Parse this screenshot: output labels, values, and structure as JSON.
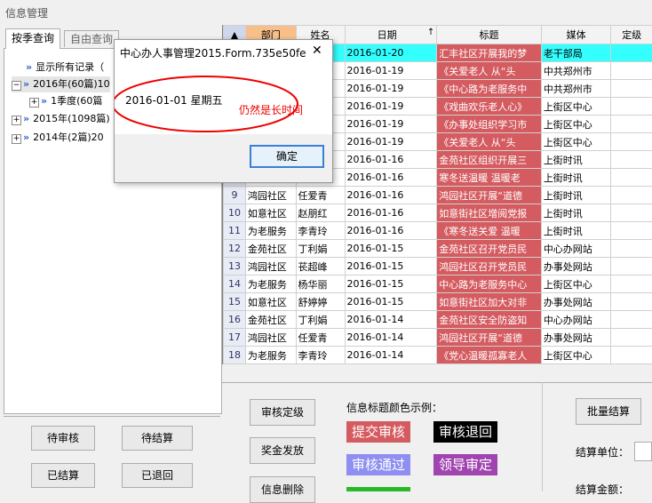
{
  "window": {
    "title": "信息管理"
  },
  "tabs": [
    {
      "label": "按季查询"
    },
    {
      "label": "自由查询"
    }
  ],
  "tree": [
    {
      "label": "显示所有记录（"
    },
    {
      "label": "2016年(60篇)10"
    },
    {
      "label": "1季度(60篇"
    },
    {
      "label": "2015年(1098篇)"
    },
    {
      "label": "2014年(2篇)20"
    }
  ],
  "left_buttons": {
    "pending_review": "待审核",
    "pending_settle": "待结算",
    "settled": "已结算",
    "returned": "已退回"
  },
  "grid": {
    "headers": [
      "部门",
      "姓名",
      "日期",
      "标题",
      "媒体",
      "定级"
    ],
    "sort_indicator": "↑",
    "rows": [
      {
        "n": "",
        "dept": "",
        "name": "",
        "date": "2016-01-20",
        "title": "汇丰社区开展我的梦",
        "media": "老干部局"
      },
      {
        "n": "",
        "dept": "",
        "name": "",
        "date": "2016-01-19",
        "title": "《关爱老人  从“头",
        "media": "中共郑州市"
      },
      {
        "n": "",
        "dept": "",
        "name": "",
        "date": "2016-01-19",
        "title": "《中心路为老服务中",
        "media": "中共郑州市"
      },
      {
        "n": "",
        "dept": "",
        "name": "",
        "date": "2016-01-19",
        "title": "《戏曲欢乐老人心》",
        "media": "上街区中心"
      },
      {
        "n": "",
        "dept": "",
        "name": "",
        "date": "2016-01-19",
        "title": "《办事处组织学习市",
        "media": "上街区中心"
      },
      {
        "n": "",
        "dept": "",
        "name": "",
        "date": "2016-01-19",
        "title": "《关爱老人  从“头",
        "media": "上街区中心"
      },
      {
        "n": "",
        "dept": "",
        "name": "",
        "date": "2016-01-16",
        "title": "金苑社区组织开展三",
        "media": "上街时讯"
      },
      {
        "n": "",
        "dept": "",
        "name": "",
        "date": "2016-01-16",
        "title": "寒冬送温暖  温暖老",
        "media": "上街时讯"
      },
      {
        "n": "9",
        "dept": "鸿园社区",
        "name": "任爱青",
        "date": "2016-01-16",
        "title": "鸿园社区开展“道德",
        "media": "上街时讯"
      },
      {
        "n": "10",
        "dept": "如意社区",
        "name": "赵朋红",
        "date": "2016-01-16",
        "title": "如意街社区增阅党报",
        "media": "上街时讯"
      },
      {
        "n": "11",
        "dept": "为老服务",
        "name": "李青玲",
        "date": "2016-01-16",
        "title": "《寒冬送关爱  温暖",
        "media": "上街时讯"
      },
      {
        "n": "12",
        "dept": "金苑社区",
        "name": "丁利娟",
        "date": "2016-01-15",
        "title": "金苑社区召开党员民",
        "media": "中心办网站"
      },
      {
        "n": "13",
        "dept": "鸿园社区",
        "name": "苌超峰",
        "date": "2016-01-15",
        "title": "鸿园社区召开党员民",
        "media": "办事处网站"
      },
      {
        "n": "14",
        "dept": "为老服务",
        "name": "杨华丽",
        "date": "2016-01-15",
        "title": "中心路为老服务中心",
        "media": "上街区中心"
      },
      {
        "n": "15",
        "dept": "如意社区",
        "name": "舒婷婷",
        "date": "2016-01-15",
        "title": "如意街社区加大对非",
        "media": "办事处网站"
      },
      {
        "n": "16",
        "dept": "金苑社区",
        "name": "丁利娟",
        "date": "2016-01-14",
        "title": "金苑社区安全防盗知",
        "media": "中心办网站"
      },
      {
        "n": "17",
        "dept": "鸿园社区",
        "name": "任爱青",
        "date": "2016-01-14",
        "title": "鸿园社区开展“道德",
        "media": "办事处网站"
      },
      {
        "n": "18",
        "dept": "为老服务",
        "name": "李青玲",
        "date": "2016-01-14",
        "title": "《党心温暖孤寡老人",
        "media": "上街区中心"
      }
    ]
  },
  "actions": {
    "review_grade": "审核定级",
    "bonus": "奖金发放",
    "delete": "信息删除",
    "batch_settle": "批量结算"
  },
  "legend": {
    "title": "信息标题颜色示例：",
    "items": [
      {
        "label": "提交审核",
        "bg": "#d45b60",
        "fg": "#ffffff"
      },
      {
        "label": "审核退回",
        "bg": "#000000",
        "fg": "#ffffff"
      },
      {
        "label": "审核通过",
        "bg": "#8f8ff2",
        "fg": "#ffffff"
      },
      {
        "label": "领导审定",
        "bg": "#a044b0",
        "fg": "#ffffff"
      }
    ]
  },
  "settle": {
    "unit_label": "结算单位：",
    "amount_label": "结算金额："
  },
  "dialog": {
    "title": "中心办人事管理2015.Form.735e50fe",
    "close": "✕",
    "message": "2016-01-01 星期五",
    "annotation": "仍然是长时间",
    "ok": "确定"
  }
}
